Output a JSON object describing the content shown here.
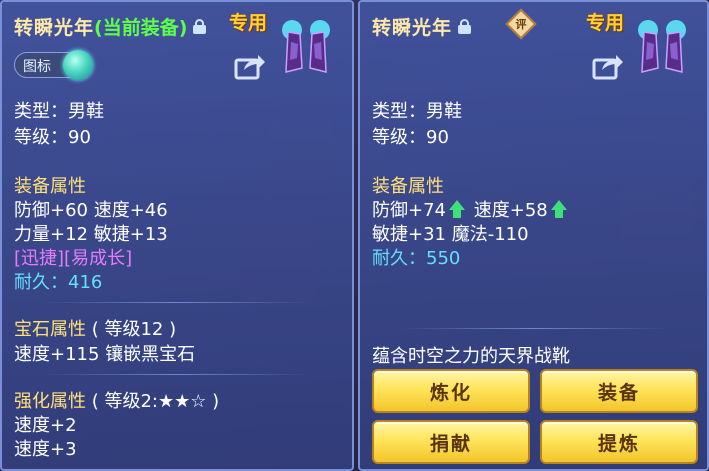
{
  "left": {
    "name": "转瞬光年",
    "equipped_tag": "(当前装备)",
    "exclusive": "专用",
    "toggle_label": "图标",
    "type_line": "类型：男鞋",
    "level_line": "等级：90",
    "equip_attr_title": "装备属性",
    "attr_line1": "防御+60 速度+46",
    "attr_line2": "力量+12 敏捷+13",
    "special": "[迅捷][易成长]",
    "durability_label": "耐久：",
    "durability_value": "416",
    "gem_title": "宝石属性",
    "gem_level": "( 等级12 )",
    "gem_line": "速度+115 镶嵌黑宝石",
    "enhance_title": "强化属性",
    "enhance_level": "( 等级2:★★☆ )",
    "enhance_line1": "速度+2",
    "enhance_line2": "速度+3"
  },
  "right": {
    "name": "转瞬光年",
    "exclusive": "专用",
    "rate_badge": "评",
    "type_line": "类型：男鞋",
    "level_line": "等级：90",
    "equip_attr_title": "装备属性",
    "attr_defense": "防御+74",
    "attr_speed": "速度+58",
    "attr_line2": "敏捷+31 魔法-110",
    "durability_label": "耐久：",
    "durability_value": "550",
    "description": "蕴含时空之力的天界战靴",
    "buttons": {
      "refine": "炼化",
      "equip": "装备",
      "donate": "捐献",
      "extract": "提炼"
    }
  },
  "colors": {
    "accent_gold": "#ffd23a",
    "value_cyan": "#63dfff",
    "up_green": "#3ee07a"
  },
  "icons": [
    "lock-icon",
    "boots-item-icon",
    "share-icon",
    "up-arrow-icon",
    "rate-badge-icon"
  ]
}
